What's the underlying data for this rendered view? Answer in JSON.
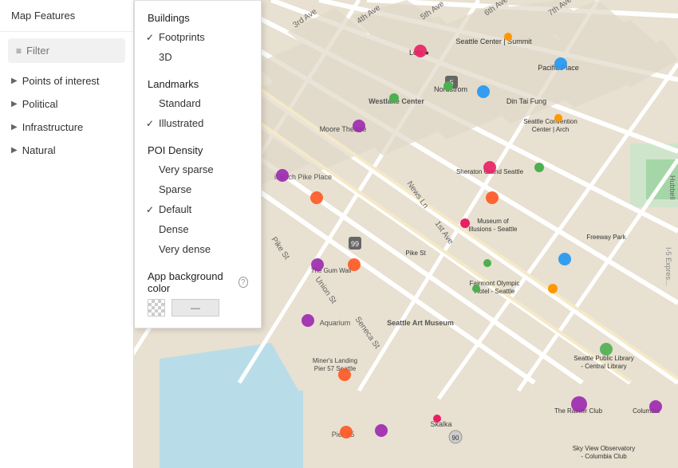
{
  "sidebar": {
    "header": "Map Features",
    "filter_placeholder": "Filter",
    "items": [
      {
        "label": "Points of interest",
        "chevron": "▶"
      },
      {
        "label": "Political",
        "chevron": "▶"
      },
      {
        "label": "Infrastructure",
        "chevron": "▶"
      },
      {
        "label": "Natural",
        "chevron": "▶"
      }
    ]
  },
  "gear_icon": "⚙",
  "dropdown": {
    "sections": [
      {
        "header": "Buildings",
        "items": [
          {
            "label": "Footprints",
            "checked": true
          },
          {
            "label": "3D",
            "checked": false
          }
        ]
      },
      {
        "header": "Landmarks",
        "items": [
          {
            "label": "Standard",
            "checked": false
          },
          {
            "label": "Illustrated",
            "checked": true
          }
        ]
      },
      {
        "header": "POI Density",
        "items": [
          {
            "label": "Very sparse",
            "checked": false
          },
          {
            "label": "Sparse",
            "checked": false
          },
          {
            "label": "Default",
            "checked": true
          },
          {
            "label": "Dense",
            "checked": false
          },
          {
            "label": "Very dense",
            "checked": false
          }
        ]
      }
    ],
    "bg_color_label": "App background color",
    "bg_color_info": "?",
    "bg_color_value": "—"
  },
  "colors": {
    "accent": "#4285f4",
    "road": "#ffffff",
    "water": "#a8d8ea",
    "building": "#e8e0d4",
    "park": "#c8e6c9"
  }
}
